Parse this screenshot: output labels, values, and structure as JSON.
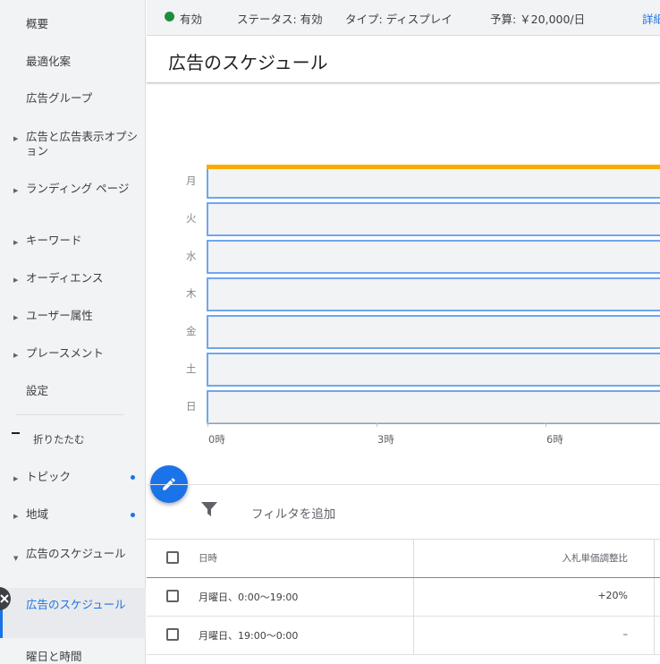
{
  "sidebar": {
    "items": [
      {
        "label": "概要"
      },
      {
        "label": "最適化案"
      },
      {
        "label": "広告グループ"
      },
      {
        "label": "広告と広告表示オプション"
      },
      {
        "label": "ランディング ページ"
      },
      {
        "label": "キーワード"
      },
      {
        "label": "オーディエンス"
      },
      {
        "label": "ユーザー属性"
      },
      {
        "label": "プレースメント"
      },
      {
        "label": "設定"
      }
    ],
    "collapse_label": "折りたたむ",
    "extra_items": [
      {
        "label": "トピック"
      },
      {
        "label": "地域"
      },
      {
        "label": "広告のスケジュール"
      },
      {
        "label": "広告のスケジュール"
      },
      {
        "label": "曜日と時間"
      }
    ]
  },
  "status": {
    "state": "有効",
    "status_text": "ステータス: 有効",
    "type_text": "タイプ: ディスプレイ",
    "budget_text": "予算: ￥20,000/日",
    "details_link": "詳細"
  },
  "page_title": "広告のスケジュール",
  "chart_data": {
    "type": "heatmap",
    "days": [
      "月",
      "火",
      "水",
      "木",
      "金",
      "土",
      "日"
    ],
    "x_ticks": [
      "0時",
      "3時",
      "6時"
    ],
    "highlight_day": "月"
  },
  "filter_label": "フィルタを追加",
  "table": {
    "headers": {
      "datetime": "日時",
      "bid_adjustment": "入札単価調整比"
    },
    "rows": [
      {
        "datetime": "月曜日、0:00～19:00",
        "bid_adjustment": "+20%"
      },
      {
        "datetime": "月曜日、19:00～0:00",
        "bid_adjustment": "–"
      }
    ]
  },
  "colors": {
    "accent": "#1a73e8",
    "status_green": "#1e8e3e",
    "highlight": "#f9ab00"
  }
}
